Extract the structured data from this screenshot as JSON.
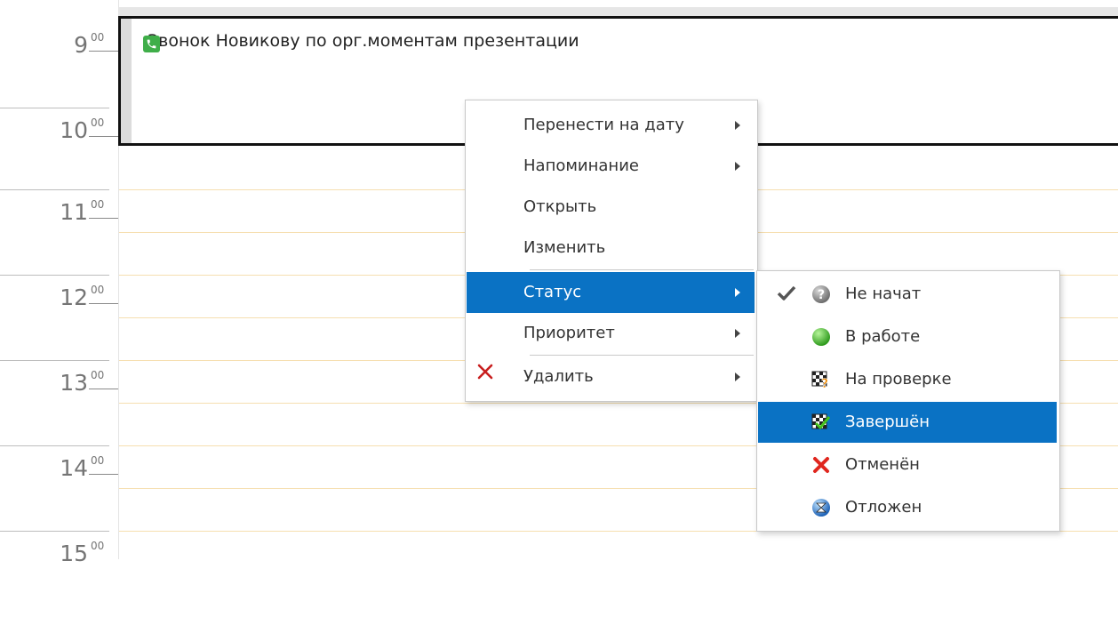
{
  "time_gutter": {
    "hours": [
      {
        "hour": "9",
        "minutes": "00"
      },
      {
        "hour": "10",
        "minutes": "00"
      },
      {
        "hour": "11",
        "minutes": "00"
      },
      {
        "hour": "12",
        "minutes": "00"
      },
      {
        "hour": "13",
        "minutes": "00"
      },
      {
        "hour": "14",
        "minutes": "00"
      },
      {
        "hour": "15",
        "minutes": "00"
      }
    ]
  },
  "event": {
    "icon": "phone-icon",
    "title": "Звонок Новикову по орг.моментам презентации",
    "icon_color": "#3fae49"
  },
  "context_menu": {
    "items": [
      {
        "label": "Перенести на дату",
        "has_submenu": true
      },
      {
        "label": "Напоминание",
        "has_submenu": true
      },
      {
        "label": "Открыть",
        "has_submenu": false
      },
      {
        "label": "Изменить",
        "has_submenu": false
      },
      {
        "label": "Статус",
        "has_submenu": true,
        "highlighted": true
      },
      {
        "label": "Приоритет",
        "has_submenu": true
      },
      {
        "label": "Удалить",
        "has_submenu": true,
        "icon": "delete-x-icon"
      }
    ]
  },
  "status_submenu": {
    "items": [
      {
        "label": "Не начат",
        "icon": "question-ball-icon",
        "checked": true
      },
      {
        "label": "В работе",
        "icon": "green-ball-icon"
      },
      {
        "label": "На проверке",
        "icon": "checker-question-icon"
      },
      {
        "label": "Завершён",
        "icon": "checker-done-icon",
        "highlighted": true
      },
      {
        "label": "Отменён",
        "icon": "red-x-icon"
      },
      {
        "label": "Отложен",
        "icon": "postponed-icon"
      }
    ]
  },
  "colors": {
    "highlight": "#0a72c4",
    "grid_line": "#f6dfb0",
    "event_border": "#111111"
  }
}
